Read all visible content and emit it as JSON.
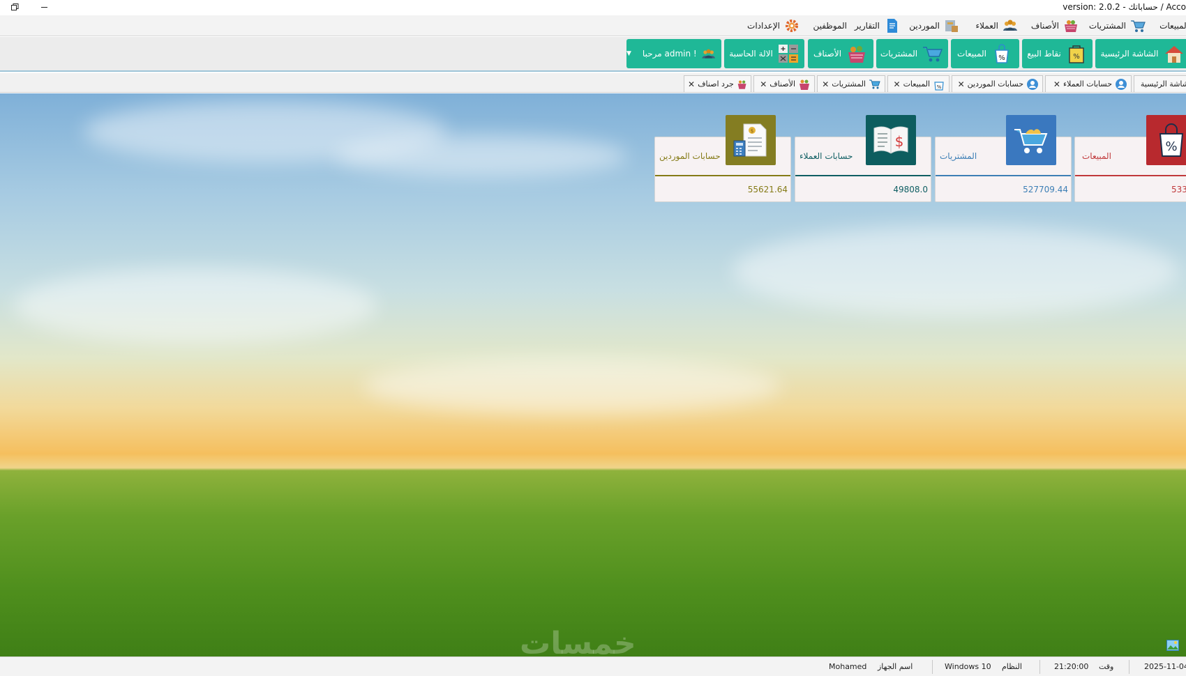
{
  "titlebar": {
    "title": "version: 2.0.2 - حساباتك / Acco"
  },
  "menu": [
    {
      "label": "المبيعات",
      "icon": "cart-icon"
    },
    {
      "label": "المشتريات",
      "icon": "cart-icon"
    },
    {
      "label": "الأصناف",
      "icon": "basket-icon"
    },
    {
      "label": "العملاء",
      "icon": "people-icon"
    },
    {
      "label": "الموردين",
      "icon": "supplier-icon"
    },
    {
      "label": "التقارير",
      "icon": "report-icon"
    },
    {
      "label": "الموظفين",
      "icon": ""
    },
    {
      "label": "الإعدادات",
      "icon": "gear-icon"
    }
  ],
  "toolbar": [
    {
      "label": "الشاشة الرئيسية",
      "icon": "home-icon"
    },
    {
      "label": "نقاط البيع",
      "icon": "pos-bag-icon"
    },
    {
      "label": "المبيعات",
      "icon": "sales-bag-icon"
    },
    {
      "label": "المشتريات",
      "icon": "cart-icon"
    },
    {
      "label": "الأصناف",
      "icon": "basket-icon"
    },
    {
      "label": "الالة الحاسبة",
      "icon": "calculator-icon"
    },
    {
      "label": "مرحبا admin !",
      "icon": "users-icon"
    }
  ],
  "tabs": [
    {
      "label": "شاشة الرئيسية"
    },
    {
      "label": "حسابات العملاء"
    },
    {
      "label": "حسابات الموردين"
    },
    {
      "label": "المبيعات"
    },
    {
      "label": "المشتريات"
    },
    {
      "label": "الأصناف"
    },
    {
      "label": "جرد اصناف"
    }
  ],
  "cards": [
    {
      "label": "المبيعات",
      "value": "533",
      "color": "#c0393b",
      "icon_bg": "#b8292e"
    },
    {
      "label": "المشتريات",
      "value": "527709.44",
      "color": "#3d7fb5",
      "icon_bg": "#3a78bf"
    },
    {
      "label": "حسابات العملاء",
      "value": "49808.0",
      "color": "#0f5e62",
      "icon_bg": "#0d5d5f"
    },
    {
      "label": "حسابات الموردين",
      "value": "55621.64",
      "color": "#857b17",
      "icon_bg": "#847d22"
    }
  ],
  "watermark": "خمسات",
  "status": {
    "date": "2025-11-04",
    "time_label": "وقت",
    "time": "21:20:00",
    "os_label": "النظام",
    "os": "Windows 10",
    "device_label": "اسم الجهاز",
    "device": "Mohamed"
  }
}
